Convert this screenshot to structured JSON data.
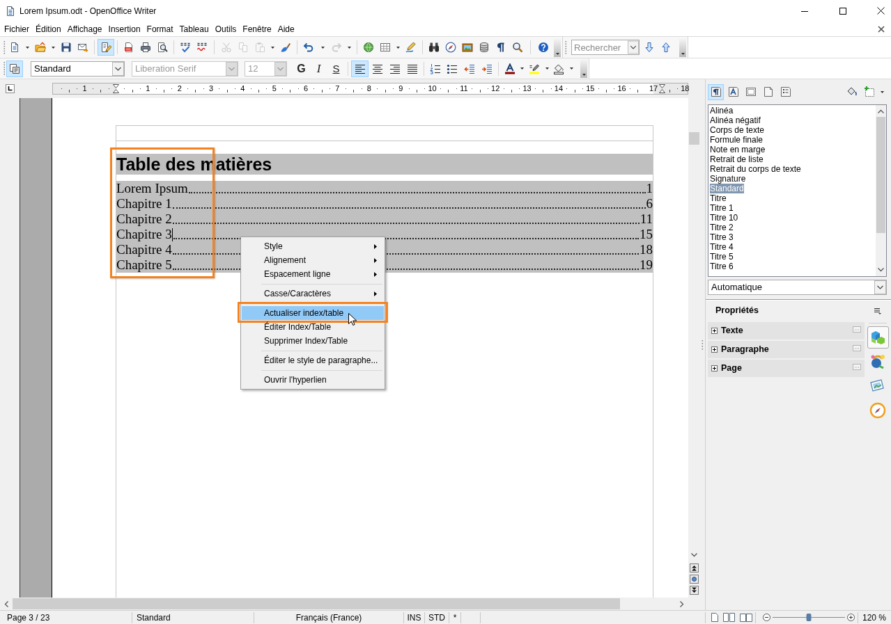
{
  "window": {
    "title": "Lorem Ipsum.odt - OpenOffice Writer"
  },
  "menu_bar": [
    "Fichier",
    "Édition",
    "Affichage",
    "Insertion",
    "Format",
    "Tableau",
    "Outils",
    "Fenêtre",
    "Aide"
  ],
  "standard_toolbar": {
    "edit_file": {
      "on": true
    },
    "cut": {
      "disabled": true
    },
    "copy": {
      "disabled": true
    },
    "paste": {
      "disabled": true
    },
    "redo": {
      "disabled": true
    }
  },
  "find_toolbar": {
    "search": {
      "placeholder": "Rechercher"
    }
  },
  "formatting_toolbar": {
    "styles_window": {
      "on": true
    },
    "paragraph_style": "Standard",
    "font_name": {
      "value": "Liberation Serif",
      "disabled": true
    },
    "font_size": {
      "value": "12",
      "disabled": true
    },
    "character_buttons": [
      "G",
      "I",
      "S"
    ],
    "alignment": [
      {
        "selected": true
      },
      {
        "selected": false
      },
      {
        "selected": false
      },
      {
        "selected": false
      }
    ]
  },
  "ruler": {
    "labels": [
      "1",
      "1",
      "2",
      "3",
      "4",
      "5",
      "6",
      "7",
      "8",
      "9",
      "10",
      "11",
      "12",
      "13",
      "14",
      "15",
      "16",
      "17",
      "18"
    ]
  },
  "document": {
    "toc": {
      "title": "Table des matières",
      "highlight_frame": true,
      "entries": [
        {
          "text": "Lorem Ipsum",
          "page": "1",
          "cursor": false
        },
        {
          "text": "Chapitre 1",
          "page": "6",
          "cursor": false
        },
        {
          "text": "Chapitre 2",
          "page": "11",
          "cursor": false
        },
        {
          "text": "Chapitre 3",
          "page": "15",
          "cursor": true
        },
        {
          "text": "Chapitre 4",
          "page": "18",
          "cursor": false
        },
        {
          "text": "Chapitre 5",
          "page": "19",
          "cursor": false
        }
      ]
    }
  },
  "context_menu": {
    "groups": [
      [
        {
          "label": "Style",
          "submenu": true,
          "selected": false,
          "highlight_frame": false
        },
        {
          "label": "Alignement",
          "submenu": true,
          "selected": false,
          "highlight_frame": false
        },
        {
          "label": "Espacement ligne",
          "submenu": true,
          "selected": false,
          "highlight_frame": false
        }
      ],
      [
        {
          "label": "Casse/Caractères",
          "submenu": true,
          "selected": false,
          "highlight_frame": false
        }
      ],
      [
        {
          "label": "Actualiser index/table",
          "submenu": false,
          "selected": true,
          "highlight_frame": true
        },
        {
          "label": "Éditer Index/Table",
          "submenu": false,
          "selected": false,
          "highlight_frame": false
        },
        {
          "label": "Supprimer Index/Table",
          "submenu": false,
          "selected": false,
          "highlight_frame": false
        }
      ],
      [
        {
          "label": "Éditer le style de paragraphe...",
          "submenu": false,
          "selected": false,
          "highlight_frame": false
        }
      ],
      [
        {
          "label": "Ouvrir l'hyperlien",
          "submenu": false,
          "selected": false,
          "highlight_frame": false
        }
      ]
    ]
  },
  "styles_panel": {
    "categories": [
      {
        "selected": true
      },
      {
        "selected": false
      },
      {
        "selected": false
      },
      {
        "selected": false
      },
      {
        "selected": false
      }
    ],
    "styles": [
      {
        "label": "Alinéa",
        "selected": false
      },
      {
        "label": "Alinéa négatif",
        "selected": false
      },
      {
        "label": "Corps de texte",
        "selected": false
      },
      {
        "label": "Formule finale",
        "selected": false
      },
      {
        "label": "Note en marge",
        "selected": false
      },
      {
        "label": "Retrait de liste",
        "selected": false
      },
      {
        "label": "Retrait du corps de texte",
        "selected": false
      },
      {
        "label": "Signature",
        "selected": false
      },
      {
        "label": "Standard",
        "selected": true
      },
      {
        "label": "Titre",
        "selected": false
      },
      {
        "label": "Titre 1",
        "selected": false
      },
      {
        "label": "Titre 10",
        "selected": false
      },
      {
        "label": "Titre 2",
        "selected": false
      },
      {
        "label": "Titre 3",
        "selected": false
      },
      {
        "label": "Titre 4",
        "selected": false
      },
      {
        "label": "Titre 5",
        "selected": false
      },
      {
        "label": "Titre 6",
        "selected": false
      }
    ],
    "filter": "Automatique"
  },
  "properties_panel": {
    "title": "Propriétés",
    "sections": [
      {
        "label": "Texte",
        "expanded": false
      },
      {
        "label": "Paragraphe",
        "expanded": false
      },
      {
        "label": "Page",
        "expanded": false
      }
    ],
    "tabs": [
      {
        "selected": true
      },
      {
        "selected": false
      },
      {
        "selected": false
      },
      {
        "selected": false
      }
    ]
  },
  "status_bar": {
    "page": "Page 3 / 23",
    "page_style": "Standard",
    "language": "Français (France)",
    "insert_mode": "INS",
    "selection_mode": "STD",
    "modified": "*",
    "zoom": {
      "level": 0.5,
      "reading": "120 %"
    }
  }
}
